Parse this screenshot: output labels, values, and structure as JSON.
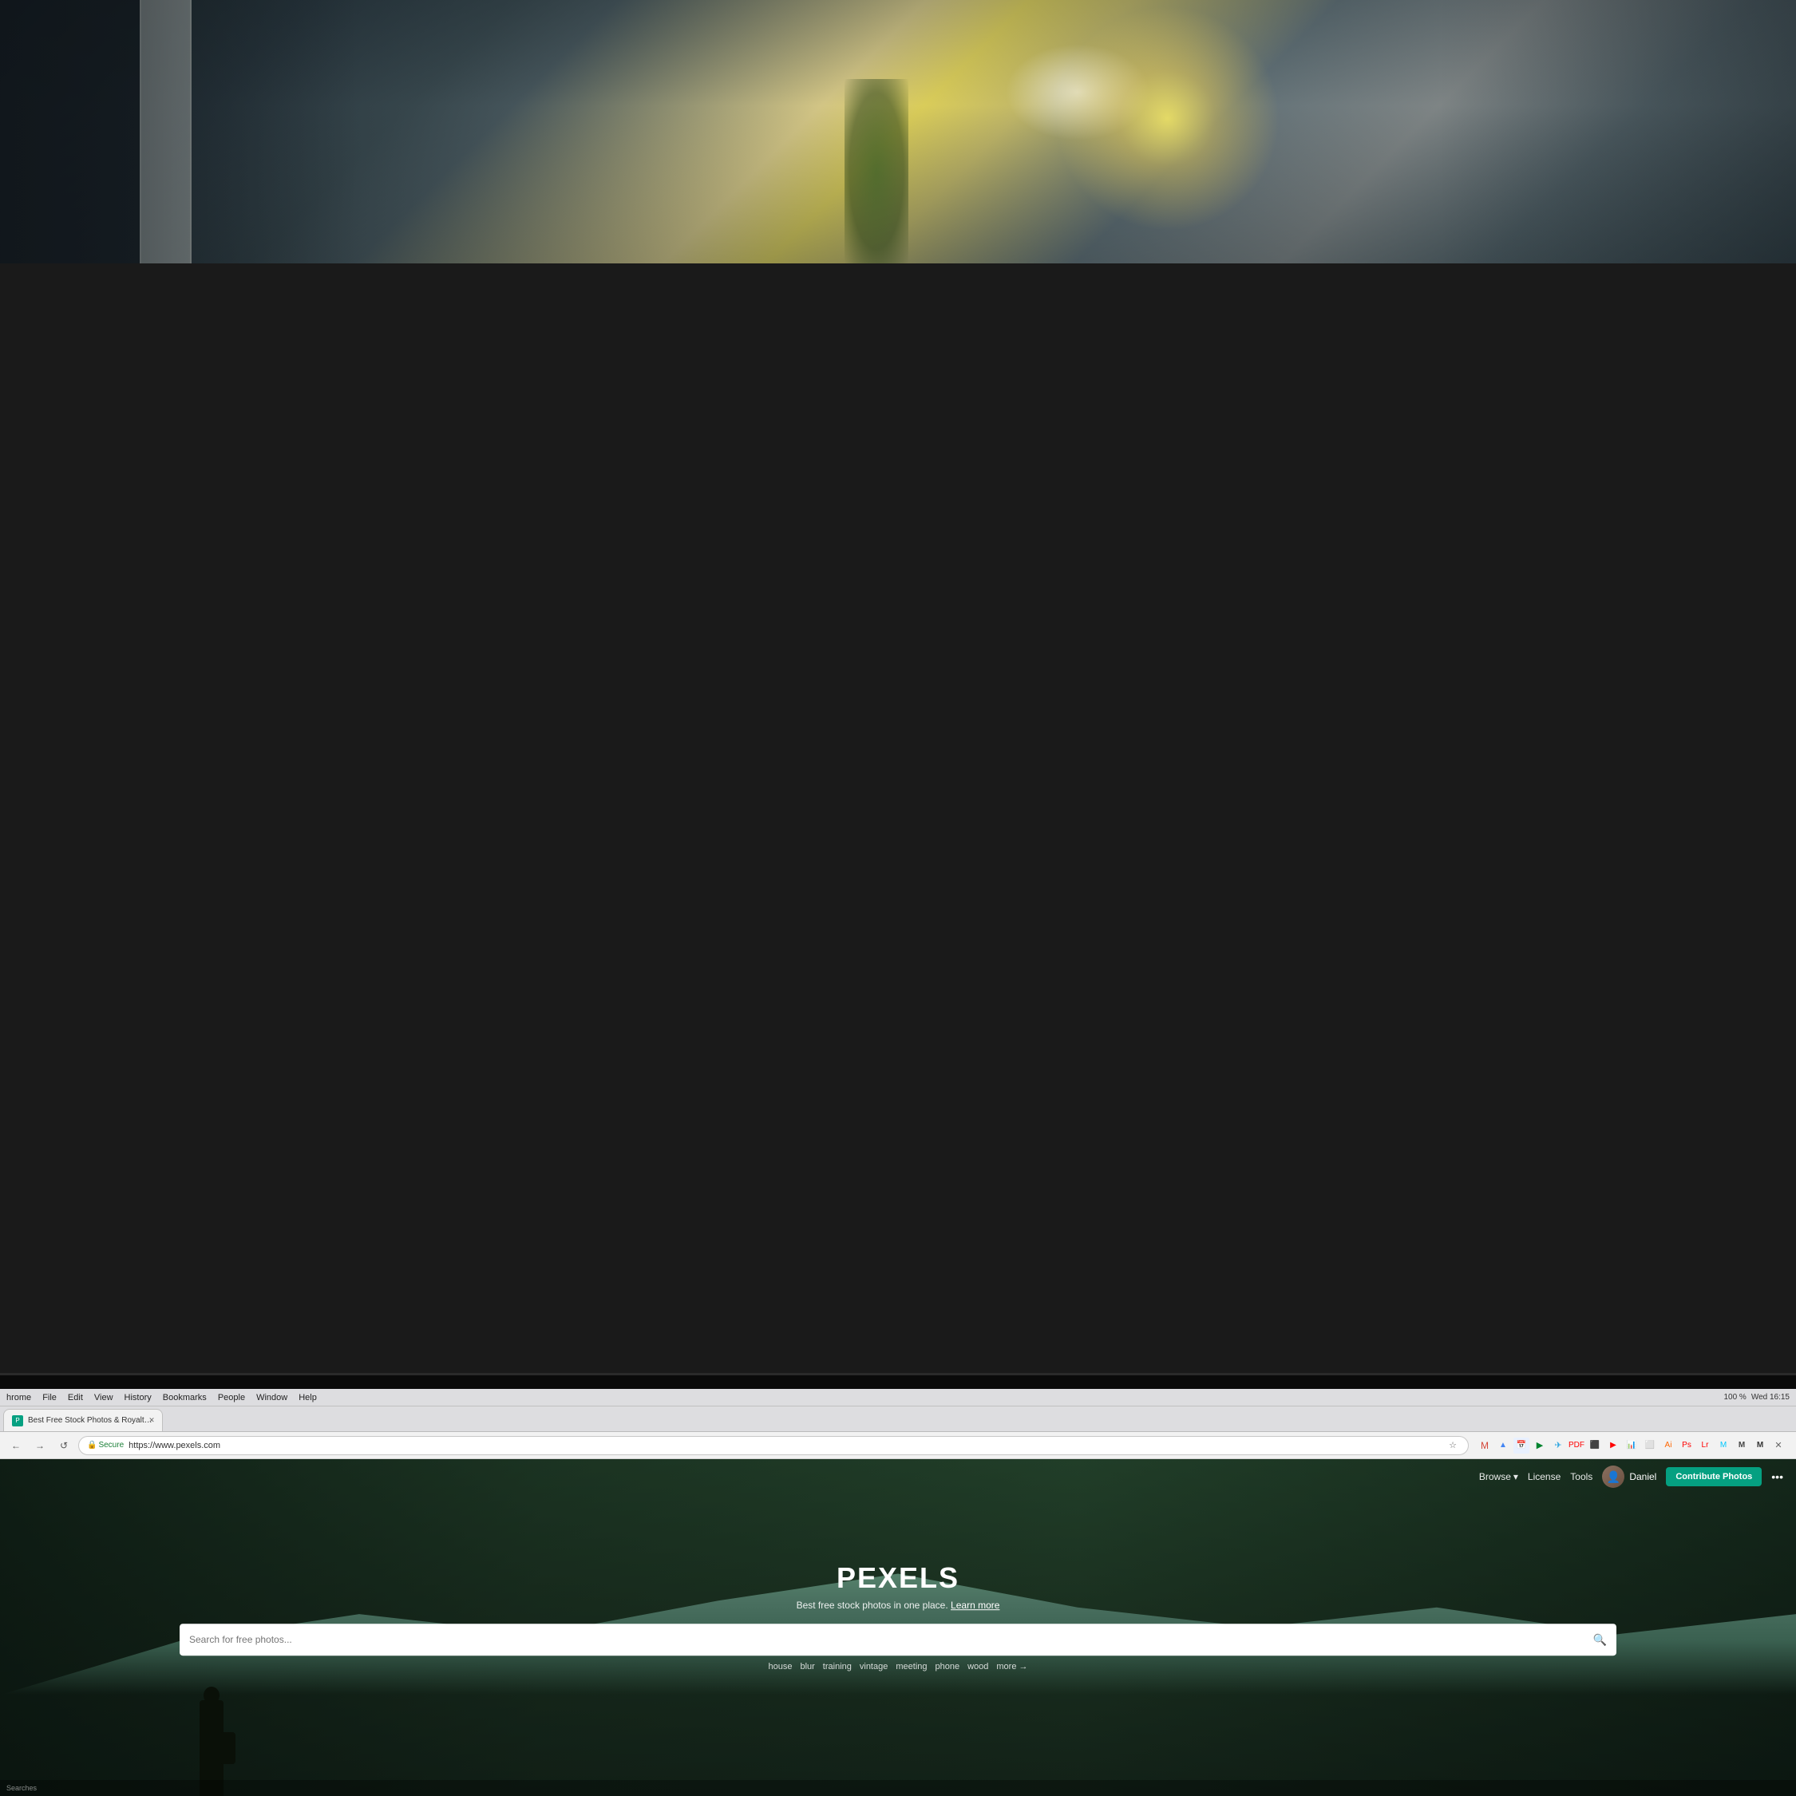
{
  "photo_bg": {
    "description": "Office interior background photo with blurred bokeh, sunlight through windows, plants and chairs"
  },
  "browser": {
    "tab": {
      "favicon_label": "P",
      "title": "Best Free Stock Photos & Royalty Free Images – Pexels"
    },
    "addressbar": {
      "secure_label": "Secure",
      "url": "https://www.pexels.com",
      "back_icon": "←",
      "forward_icon": "→",
      "reload_icon": "↺"
    },
    "menubar": {
      "items": [
        "hrome",
        "File",
        "Edit",
        "View",
        "History",
        "Bookmarks",
        "People",
        "Window",
        "Help"
      ],
      "time": "Wed 16:15",
      "battery": "100 %"
    }
  },
  "pexels": {
    "nav": {
      "browse_label": "Browse",
      "license_label": "License",
      "tools_label": "Tools",
      "username": "Daniel",
      "contribute_label": "Contribute Photos",
      "more_icon": "•••"
    },
    "hero": {
      "logo": "PEXELS",
      "subtitle": "Best free stock photos in one place.",
      "learn_more": "Learn more",
      "search_placeholder": "Search for free photos...",
      "search_icon": "🔍",
      "tags": [
        "house",
        "blur",
        "training",
        "vintage",
        "meeting",
        "phone",
        "wood"
      ],
      "more_tag": "more →"
    }
  },
  "icons": {
    "lock": "🔒",
    "star": "★",
    "chevron_down": "▾",
    "search": "🔍",
    "more": "⋯"
  }
}
